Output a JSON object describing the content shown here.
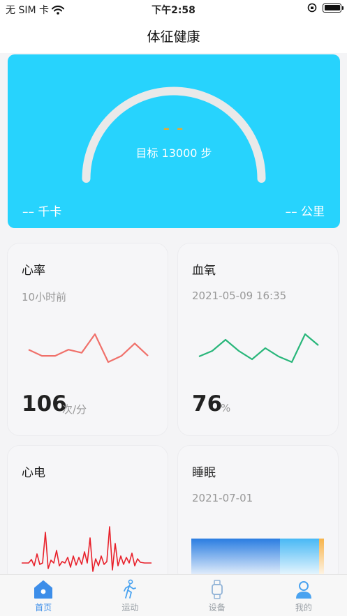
{
  "status_bar": {
    "carrier": "无 SIM 卡",
    "time": "下午2:58"
  },
  "nav": {
    "title": "体征健康"
  },
  "hero": {
    "steps": "– –",
    "goal": "目标 13000 步",
    "kcal": "–– 千卡",
    "km": "–– 公里",
    "progress": 0,
    "colors": {
      "background": "#27d3fd",
      "steps": "#f5a623",
      "track": "#e9e9e9"
    }
  },
  "cards": {
    "heart_rate": {
      "title": "心率",
      "subtitle": "10小时前",
      "value": "106",
      "unit": "次/分",
      "color": "#f0706a",
      "trend": [
        4,
        5,
        5,
        4,
        4.5,
        1.5,
        6,
        5,
        3,
        5
      ]
    },
    "blood_oxygen": {
      "title": "血氧",
      "subtitle": "2021-05-09 16:35",
      "value": "76",
      "unit": "%",
      "color": "#28b67a",
      "trend": [
        4,
        3,
        1,
        3,
        4.5,
        2.5,
        4,
        5,
        0,
        2
      ]
    },
    "ecg": {
      "title": "心电",
      "color": "#e8212b"
    },
    "sleep": {
      "title": "睡眠",
      "subtitle": "2021-07-01"
    }
  },
  "tabs": [
    {
      "label": "首页",
      "icon": "home-icon",
      "active": true
    },
    {
      "label": "运动",
      "icon": "walking-icon",
      "active": false
    },
    {
      "label": "设备",
      "icon": "watch-icon",
      "active": false
    },
    {
      "label": "我的",
      "icon": "person-icon",
      "active": false
    }
  ]
}
